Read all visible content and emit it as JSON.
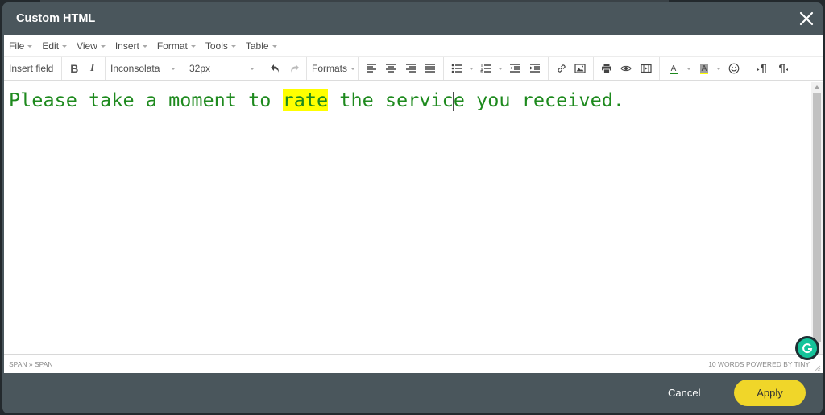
{
  "dialog": {
    "title": "Custom HTML",
    "close_icon": "close-icon"
  },
  "menubar": {
    "items": [
      {
        "label": "File"
      },
      {
        "label": "Edit"
      },
      {
        "label": "View"
      },
      {
        "label": "Insert"
      },
      {
        "label": "Format"
      },
      {
        "label": "Tools"
      },
      {
        "label": "Table"
      }
    ]
  },
  "toolbar": {
    "insert_field_label": "Insert field",
    "bold_icon": "bold-icon",
    "italic_icon": "italic-icon",
    "font_family": "Inconsolata",
    "font_size": "32px",
    "undo_icon": "undo-icon",
    "redo_icon": "redo-icon",
    "formats_label": "Formats",
    "align_icons": [
      "align-left-icon",
      "align-center-icon",
      "align-right-icon",
      "align-justify-icon"
    ],
    "list_icons": [
      "bullet-list-icon",
      "numbered-list-icon"
    ],
    "indent_icons": [
      "outdent-icon",
      "indent-icon"
    ],
    "insert_icons": [
      "link-icon",
      "image-icon"
    ],
    "misc_icons": [
      "print-icon",
      "preview-icon",
      "media-icon"
    ],
    "text_color": "#1e8a1e",
    "highlight_color": "#ffff00",
    "emoji_icon": "emoji-icon",
    "direction_icons": [
      "ltr-icon",
      "rtl-icon"
    ]
  },
  "content": {
    "before": "Please take a moment to ",
    "highlighted": "rate",
    "middle": " the servic",
    "after": "e you received.",
    "text_color": "#1e8a1e",
    "highlight_color": "#ffff00"
  },
  "statusbar": {
    "path": "SPAN » SPAN",
    "word_count": "10 WORDS POWERED BY TINY"
  },
  "footer": {
    "cancel_label": "Cancel",
    "apply_label": "Apply",
    "apply_color": "#f0d629"
  }
}
